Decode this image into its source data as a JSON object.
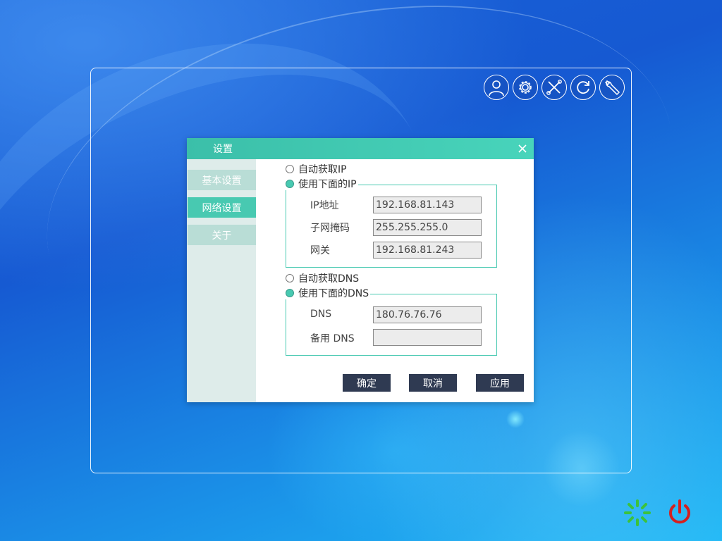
{
  "toolbar": {
    "icons": [
      "user-icon",
      "gear-icon",
      "tools-icon",
      "refresh-icon",
      "wrench-icon"
    ]
  },
  "dialog": {
    "title": "设置",
    "sidebar": [
      {
        "label": "基本设置",
        "active": false
      },
      {
        "label": "网络设置",
        "active": true
      },
      {
        "label": "关于",
        "active": false
      }
    ],
    "ip": {
      "auto_label": "自动获取IP",
      "manual_label": "使用下面的IP",
      "selected": "manual",
      "fields": [
        {
          "label": "IP地址",
          "value": "192.168.81.143"
        },
        {
          "label": "子网掩码",
          "value": "255.255.255.0"
        },
        {
          "label": "网关",
          "value": "192.168.81.243"
        }
      ]
    },
    "dns": {
      "auto_label": "自动获取DNS",
      "manual_label": "使用下面的DNS",
      "selected": "manual",
      "fields": [
        {
          "label": "DNS",
          "value": "180.76.76.76"
        },
        {
          "label": "备用 DNS",
          "value": ""
        }
      ]
    },
    "buttons": {
      "ok": "确定",
      "cancel": "取消",
      "apply": "应用"
    }
  },
  "bottom_icons": [
    "loading-spinner-icon",
    "power-icon"
  ],
  "colors": {
    "accent": "#48c9b1",
    "button_dark": "#2f3a52",
    "power_red": "#d42020",
    "spinner_green": "#3cc23c"
  }
}
